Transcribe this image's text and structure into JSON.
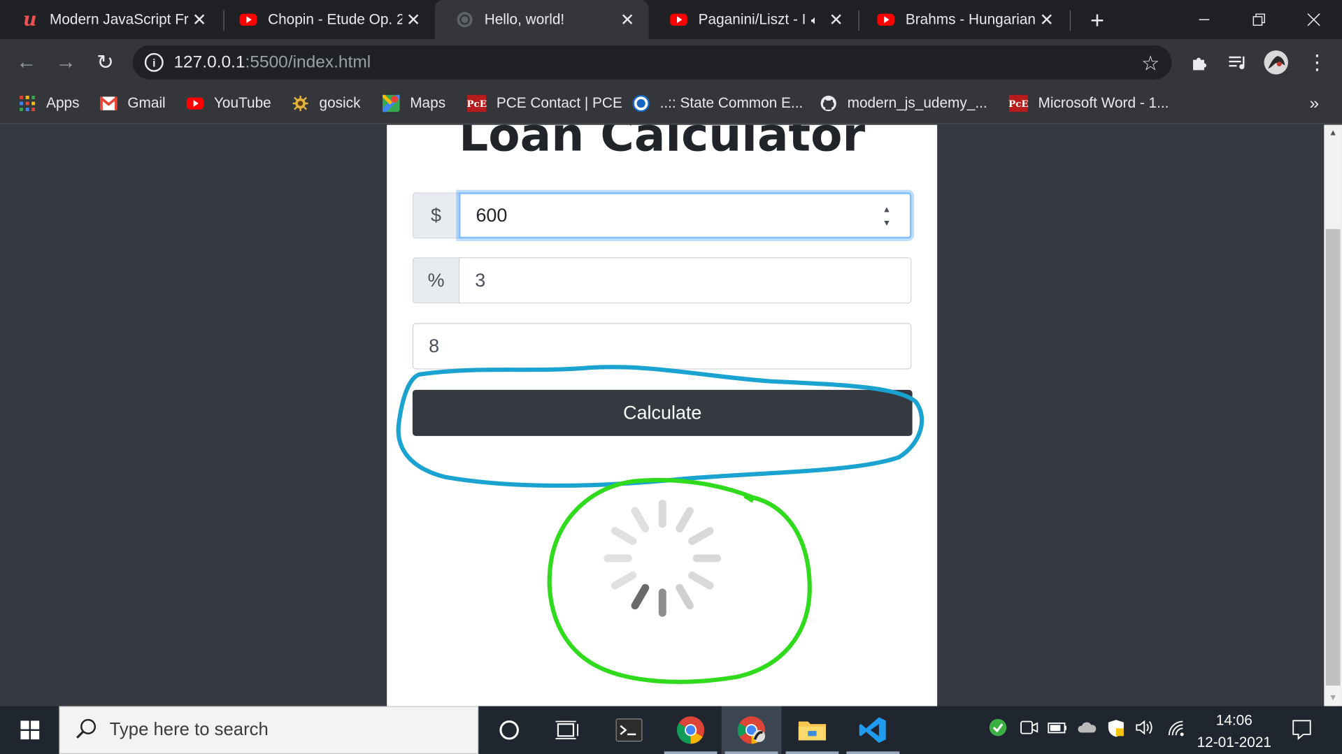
{
  "browser": {
    "tabs": [
      {
        "title": "Modern JavaScript Fr",
        "icon": "udemy-icon",
        "active": false
      },
      {
        "title": "Chopin - Etude Op. 2",
        "icon": "youtube-icon",
        "active": false
      },
      {
        "title": "Hello, world!",
        "icon": "globe-icon",
        "active": true
      },
      {
        "title": "Paganini/Liszt - I",
        "icon": "youtube-icon",
        "active": false,
        "audio": true
      },
      {
        "title": "Brahms - Hungarian",
        "icon": "youtube-icon",
        "active": false
      }
    ],
    "url_host": "127.0.0.1",
    "url_rest": ":5500/index.html",
    "bookmarks": [
      {
        "label": "Apps",
        "icon": "apps-grid-icon"
      },
      {
        "label": "Gmail",
        "icon": "gmail-icon"
      },
      {
        "label": "YouTube",
        "icon": "youtube-icon"
      },
      {
        "label": "gosick",
        "icon": "gosick-icon"
      },
      {
        "label": "Maps",
        "icon": "maps-icon"
      },
      {
        "label": "PCE Contact | PCE",
        "icon": "pce-icon"
      },
      {
        "label": "..:: State Common E...",
        "icon": "cet-icon"
      },
      {
        "label": "modern_js_udemy_...",
        "icon": "github-icon"
      },
      {
        "label": "Microsoft Word - 1...",
        "icon": "pce-icon"
      }
    ],
    "bookmarks_overflow": "»"
  },
  "app": {
    "heading": "Loan Calculator",
    "amount_prefix": "$",
    "amount_value": "600",
    "interest_prefix": "%",
    "interest_value": "3",
    "years_value": "8",
    "calculate_label": "Calculate"
  },
  "taskbar": {
    "search_placeholder": "Type here to search",
    "time": "14:06",
    "date": "12-01-2021"
  }
}
